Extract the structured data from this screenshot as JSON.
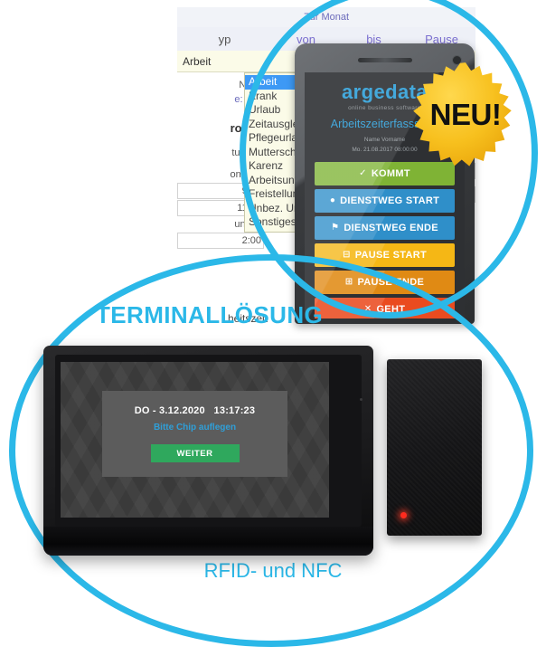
{
  "background_app": {
    "topbar_label": "Zur Monat",
    "columns": [
      "yp",
      "von",
      "bis",
      "Pause"
    ],
    "selected_cell": "Arbeit",
    "dropdown": {
      "name": "typ-dropdown",
      "selected": "Arbeit",
      "options": [
        "Arbeit",
        "Krank",
        "Urlaub",
        "Zeitausgle",
        "Pflegeurla",
        "Muttersch",
        "Karenz",
        "Arbeitsunf",
        "Freistellun",
        "Unbez. Ur",
        "Sonstiges"
      ]
    },
    "left_labels": [
      "Nach",
      "e: 340",
      "rojekt",
      "tunden",
      "on / bis",
      "9:00",
      "11:00",
      "unden",
      "2:00"
    ],
    "footer_label": "heitszeit"
  },
  "badge": {
    "label": "NEU!",
    "color": "#f5b91c"
  },
  "phone": {
    "brand": "argedata",
    "brand_sub": "online business software",
    "screen_title": "Arbeitszeiterfasssung",
    "user_name": "Name Vorname",
    "user_timestamp": "Mo. 21.08.2017 08:00:00",
    "buttons": [
      {
        "label": "KOMMT",
        "icon": "check-circle-icon",
        "glyph": "✔",
        "color": "#7fb335"
      },
      {
        "label": "DIENSTWEG START",
        "icon": "map-pin-icon",
        "glyph": "▾",
        "color": "#2f8fc9"
      },
      {
        "label": "DIENSTWEG ENDE",
        "icon": "flag-icon",
        "glyph": "⚑",
        "color": "#2f8fc9"
      },
      {
        "label": "PAUSE START",
        "icon": "minus-box-icon",
        "glyph": "➖",
        "color": "#f5b715"
      },
      {
        "label": "PAUSE ENDE",
        "icon": "plus-box-icon",
        "glyph": "➕",
        "color": "#e08a14"
      },
      {
        "label": "GEHT",
        "icon": "close-circle-icon",
        "glyph": "✖",
        "color": "#ea4b1f"
      }
    ]
  },
  "labels": {
    "terminal": "TERMINALLÖSUNG",
    "rfid": "RFID- und NFC",
    "accent_color": "#2bb8e8"
  },
  "terminal": {
    "datetime": "DO - 3.12.2020   13:17:23",
    "hint": "Bitte Chip auflegen",
    "button_label": "WEITER",
    "button_color": "#2fa85d",
    "led_color": "#ff2b1e"
  }
}
